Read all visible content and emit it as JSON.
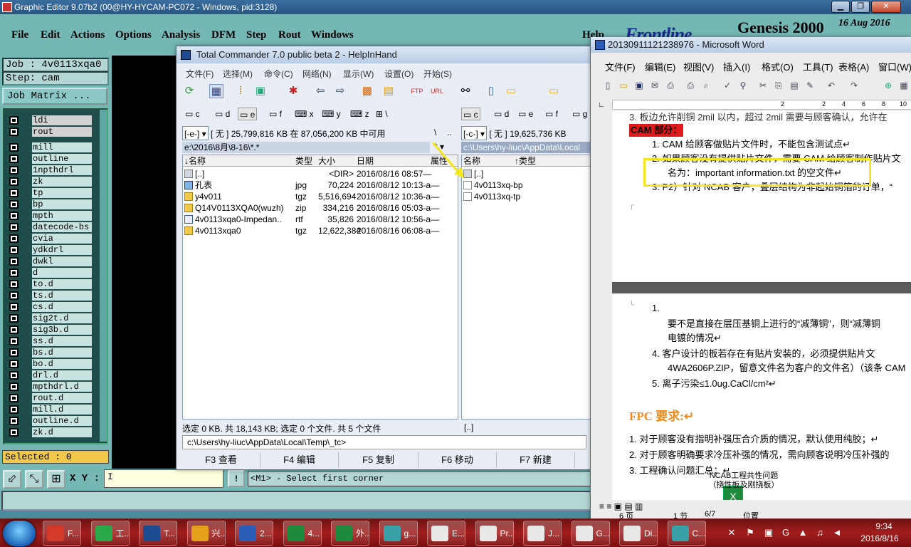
{
  "genesis": {
    "title": "Graphic Editor 9.07b2 (00@HY-HYCAM-PC072 - Windows, pid:3128)",
    "menu": [
      "File",
      "Edit",
      "Actions",
      "Options",
      "Analysis",
      "DFM",
      "Step",
      "Rout",
      "Windows",
      "Help"
    ],
    "brand": "Frontline",
    "product": "Genesis 2000",
    "date": "16 Aug 2016",
    "job": "Job : 4v0113xqa0",
    "step": "Step: cam",
    "job_matrix": "Job Matrix ...",
    "layers": [
      "ldi",
      "rout",
      "mill",
      "outline",
      "1npthdrl",
      "zk",
      "tp",
      "bp",
      "mpth",
      "datecode-bs",
      "cvia",
      "ydkdrl",
      "dwkl",
      "d",
      "to.d",
      "ts.d",
      "cs.d",
      "sig2t.d",
      "sig3b.d",
      "ss.d",
      "bs.d",
      "bo.d",
      "drl.d",
      "mpthdrl.d",
      "rout.d",
      "mill.d",
      "outline.d",
      "zk.d"
    ],
    "selected": "Selected : 0",
    "xy_label": "X Y :",
    "xy_value": "I",
    "warn": "!",
    "status": "<M1> - Select first corner"
  },
  "tc": {
    "title": "Total Commander 7.0 public beta 2 - HelpInHand",
    "menu": [
      "文件(F)",
      "选择(M)",
      "命令(C)",
      "网络(N)",
      "显示(W)",
      "设置(O)",
      "开始(S)"
    ],
    "left_drives": [
      "c",
      "d",
      "e",
      "f",
      "x",
      "y",
      "z",
      "\\"
    ],
    "right_drives": [
      "c",
      "d",
      "e",
      "f",
      "g"
    ],
    "left_drive_sel": "[-e-]",
    "left_none": "[ 无 ]",
    "left_free": "25,799,816 KB 在 87,056,200 KB 中可用",
    "left_path": "e:\\2016\\8月\\8-16\\*.*",
    "right_drive_sel": "[-c-]",
    "right_none": "[ 无 ]",
    "right_free": "19,625,736 KB",
    "right_path": "c:\\Users\\hy-liuc\\AppData\\Local",
    "cols": {
      "name": "↓名称",
      "type": "类型",
      "size": "大小",
      "date": "日期",
      "attr": "属性"
    },
    "right_cols": {
      "name": "名称",
      "type": "↑类型"
    },
    "left_files": [
      {
        "name": "[..]",
        "type": "",
        "size": "<DIR>",
        "date": "2016/08/16 08:57—",
        "icon": "up"
      },
      {
        "name": "孔表",
        "type": "jpg",
        "size": "70,224",
        "date": "2016/08/12 10:13-a—",
        "icon": "img"
      },
      {
        "name": "y4v011",
        "type": "tgz",
        "size": "5,516,694",
        "date": "2016/08/12 10:36-a—",
        "icon": "zip"
      },
      {
        "name": "Q14V0113XQA0(wuzh)",
        "type": "zip",
        "size": "334,216",
        "date": "2016/08/16 05:03-a—",
        "icon": "zip"
      },
      {
        "name": "4v0113xqa0-Impedan..",
        "type": "rtf",
        "size": "35,826",
        "date": "2016/08/12 10:56-a—",
        "icon": "rtf"
      },
      {
        "name": "4v0113xqa0",
        "type": "tgz",
        "size": "12,622,384",
        "date": "2016/08/16 06:08-a—",
        "icon": "zip"
      }
    ],
    "right_files": [
      {
        "name": "[..]",
        "icon": "up"
      },
      {
        "name": "4v0113xq-bp",
        "icon": "doc"
      },
      {
        "name": "4v0113xq-tp",
        "icon": "doc"
      }
    ],
    "status_left": "选定 0 KB. 共 18,143 KB; 选定 0 个文件. 共 5 个文件",
    "status_right": "[..]",
    "cmd_path": "c:\\Users\\hy-liuc\\AppData\\Local\\Temp\\_tc>",
    "fkeys": [
      "F3 查看",
      "F4 编辑",
      "F5 复制",
      "F6 移动",
      "F7 新建"
    ]
  },
  "word": {
    "title": "20130911121238976 - Microsoft Word",
    "menu": [
      "文件(F)",
      "编辑(E)",
      "视图(V)",
      "插入(I)",
      "格式(O)",
      "工具(T)",
      "表格(A)",
      "窗口(W)"
    ],
    "ruler": [
      "2",
      "2",
      "4",
      "6",
      "8",
      "10"
    ],
    "lines": [
      "3.   板边允许削铜 2mil 以内，超过 2mil 需要与顾客确认，允许在",
      "CAM 部分：",
      "1.   CAM 给顾客做贴片文件时，不能包含测试点↵",
      "2.   如果顾客没有提供贴片文件，需要 CAM 给顾客制作贴片文",
      "名为：important information.txt 的空文件↵",
      "3.   P2）针对 NCAB 客户，叠层结构为非起始铜箔的订单，“",
      "1.",
      "要不是直接在层压基铜上进行的“减薄铜”，则“减薄铜",
      "电镀的情况↵",
      "4.   客户设计的板若存在有贴片安装的，必须提供贴片文",
      "4WA2606P.ZIP，留意文件名为客户的文件名）（该条 CAM",
      "5.   离子污染≤1.0ug.CaCl/cm²↵",
      "FPC 要求:↵",
      "1.   对于顾客没有指明补强压合介质的情况，默认使用纯胶；↵",
      "2.   对于顾客明确要求冷压补强的情况，需向顾客说明冷压补强的",
      "3.   工程确认问题汇总：↵",
      "NCAB工程共性问题",
      "（挠性板及刚挠板）"
    ],
    "status": [
      "6 页",
      "1 节",
      "6/7",
      "位置"
    ]
  },
  "taskbar": {
    "buttons": [
      {
        "label": "F...",
        "color": "#d43a2a"
      },
      {
        "label": "工...",
        "color": "#2aa84a"
      },
      {
        "label": "T...",
        "color": "#1d4b8f"
      },
      {
        "label": "兴...",
        "color": "#e6a21c"
      },
      {
        "label": "2...",
        "color": "#2b5cb8"
      },
      {
        "label": "4...",
        "color": "#1e8a3c"
      },
      {
        "label": "外...",
        "color": "#1e8a3c"
      },
      {
        "label": "g...",
        "color": "#3aa0a8"
      },
      {
        "label": "E...",
        "color": "#e8e8e8"
      },
      {
        "label": "Pr...",
        "color": "#e8e8e8"
      },
      {
        "label": "J...",
        "color": "#e8e8e8"
      },
      {
        "label": "G...",
        "color": "#e8e8e8"
      },
      {
        "label": "Di...",
        "color": "#e8e8e8"
      },
      {
        "label": "C...",
        "color": "#3aa0a8"
      }
    ],
    "time": "9:34",
    "date": "2016/8/16"
  }
}
